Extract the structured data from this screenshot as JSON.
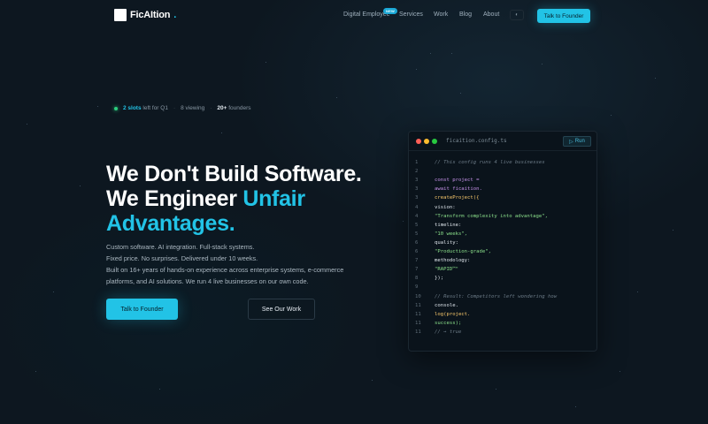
{
  "brand": {
    "name": "FicAItion",
    "dot": "."
  },
  "nav": {
    "items": [
      {
        "label": "Digital Employee",
        "badge": "NEW"
      },
      {
        "label": "Services"
      },
      {
        "label": "Work"
      },
      {
        "label": "Blog"
      },
      {
        "label": "About"
      }
    ],
    "theme_toggle": "◐",
    "cta": "Talk to Founder"
  },
  "status": {
    "slots_highlight": "2 slots",
    "slots_rest": "left for Q1",
    "viewing": "8 viewing",
    "founders_count": "20+",
    "founders_label": "founders"
  },
  "hero": {
    "line1": "We Don't Build Software.",
    "line2_plain": "We Engineer ",
    "line2_accent": "Unfair",
    "line3_accent": "Advantages.",
    "copy": [
      "Custom software. AI integration. Full-stack systems.",
      "Fixed price. No surprises. Delivered under 10 weeks.",
      "Built on 16+ years of hands-on experience across enterprise systems, e-commerce",
      "platforms, and AI solutions. We run 4 live businesses on our own code."
    ],
    "primary_button": "Talk to Founder",
    "secondary_button": "See Our Work"
  },
  "code_window": {
    "filename": "ficaition.config.ts",
    "run_label": "Run",
    "lines": [
      {
        "n": "1",
        "t": "// This config runs 4 live businesses",
        "k": "com"
      },
      {
        "n": "2",
        "t": "",
        "k": "pl"
      },
      {
        "n": "3",
        "t": "const project =",
        "k": "kw"
      },
      {
        "n": "3",
        "t": "await ficaition.",
        "k": "kw"
      },
      {
        "n": "3",
        "t": "createProject({",
        "k": "fn"
      },
      {
        "n": "4",
        "t": "vision:",
        "k": "pl"
      },
      {
        "n": "4",
        "t": "\"Transform complexity into advantage\",",
        "k": "str"
      },
      {
        "n": "5",
        "t": "timeline:",
        "k": "pl"
      },
      {
        "n": "5",
        "t": "\"10 weeks\",",
        "k": "str"
      },
      {
        "n": "6",
        "t": "quality:",
        "k": "pl"
      },
      {
        "n": "6",
        "t": "\"Production-grade\",",
        "k": "str"
      },
      {
        "n": "7",
        "t": "methodology:",
        "k": "pl"
      },
      {
        "n": "7",
        "t": "\"RAPID™\"",
        "k": "str"
      },
      {
        "n": "8",
        "t": "});",
        "k": "pl"
      },
      {
        "n": "9",
        "t": "",
        "k": "pl"
      },
      {
        "n": "10",
        "t": "// Result: Competitors left wondering how",
        "k": "com"
      },
      {
        "n": "11",
        "t": "console.",
        "k": "pl"
      },
      {
        "n": "11",
        "t": "log(project.",
        "k": "fn"
      },
      {
        "n": "11",
        "t": "success);",
        "k": "str"
      },
      {
        "n": "11",
        "t": "// → true",
        "k": "com"
      }
    ]
  }
}
